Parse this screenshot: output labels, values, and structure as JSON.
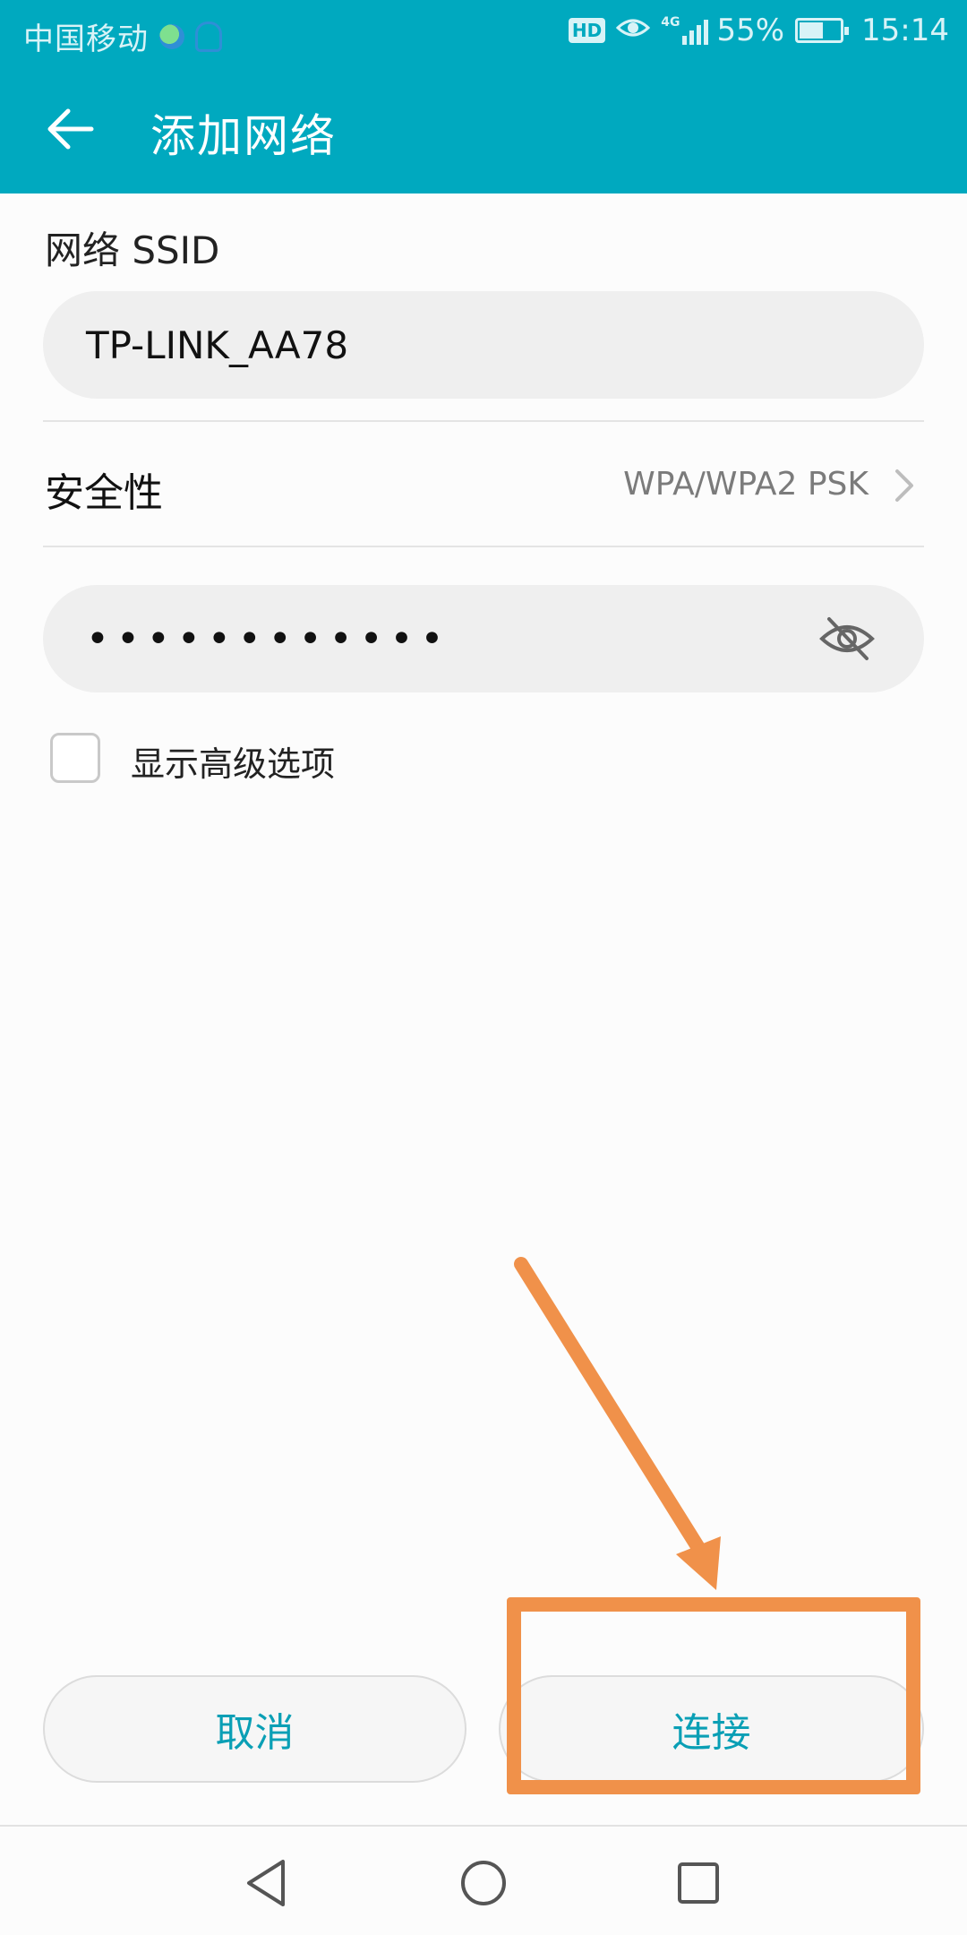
{
  "status_bar": {
    "carrier": "中国移动",
    "hd_badge": "HD",
    "network_type": "4G",
    "battery_percent": "55%",
    "battery_level": 0.55,
    "time": "15:14"
  },
  "app_bar": {
    "title": "添加网络",
    "back_icon": "arrow-left-icon"
  },
  "form": {
    "ssid_label": "网络 SSID",
    "ssid_value": "TP-LINK_AA78",
    "security_label": "安全性",
    "security_value": "WPA/WPA2 PSK",
    "password_masked": "••••••••••••",
    "password_visibility_icon": "eye-off-icon",
    "advanced_label": "显示高级选项",
    "advanced_checked": false
  },
  "buttons": {
    "cancel": "取消",
    "connect": "连接"
  },
  "annotation": {
    "color": "#f0914a",
    "target": "connect"
  },
  "colors": {
    "accent": "#00a9bf",
    "button_text": "#0a9fb5"
  },
  "nav_bar": {
    "back_icon": "nav-back-icon",
    "home_icon": "nav-home-icon",
    "recent_icon": "nav-recent-icon"
  }
}
